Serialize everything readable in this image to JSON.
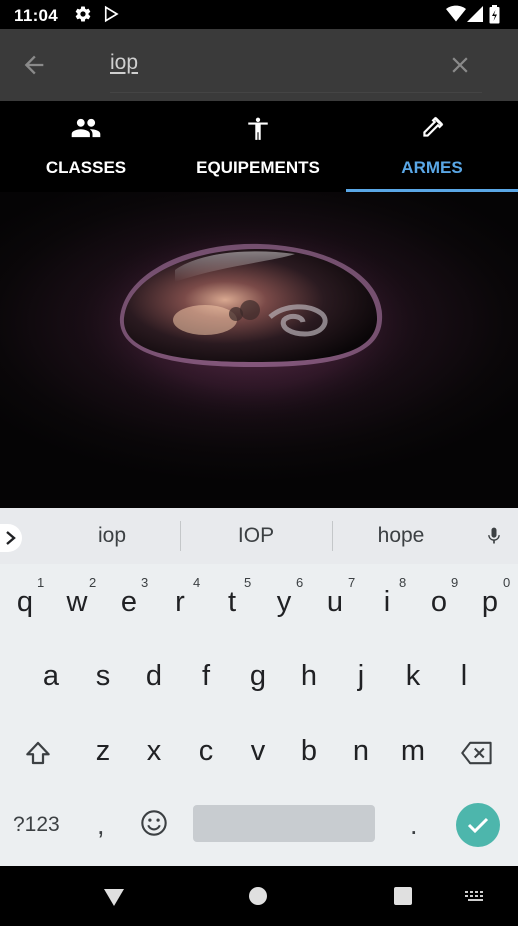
{
  "status_bar": {
    "time": "11:04",
    "icons": [
      "settings-gear-icon",
      "play-store-icon",
      "wifi-icon",
      "signal-icon",
      "battery-icon"
    ]
  },
  "search": {
    "query": "iop",
    "icons": [
      "arrow-back-icon",
      "close-icon"
    ]
  },
  "tabs": [
    {
      "label": "CLASSES",
      "icon": "people-icon",
      "active": false
    },
    {
      "label": "EQUIPEMENTS",
      "icon": "person-accessibility-icon",
      "active": false
    },
    {
      "label": "ARMES",
      "icon": "eyedropper-icon",
      "active": true
    }
  ],
  "content": {
    "image": "dofus-egg-image"
  },
  "keyboard": {
    "suggestions": [
      "iop",
      "IOP",
      "hope"
    ],
    "row1": [
      "q",
      "w",
      "e",
      "r",
      "t",
      "y",
      "u",
      "i",
      "o",
      "p"
    ],
    "row1_hints": [
      "1",
      "2",
      "3",
      "4",
      "5",
      "6",
      "7",
      "8",
      "9",
      "0"
    ],
    "row2": [
      "a",
      "s",
      "d",
      "f",
      "g",
      "h",
      "j",
      "k",
      "l"
    ],
    "row3": [
      "z",
      "x",
      "c",
      "v",
      "b",
      "n",
      "m"
    ],
    "symbols_key": "?123",
    "comma": ",",
    "period": "."
  },
  "colors": {
    "accent": "#5aa7e6",
    "enter_key": "#4db6ac",
    "search_bar": "#3a3a3a",
    "keyboard_bg": "#eceff1"
  }
}
